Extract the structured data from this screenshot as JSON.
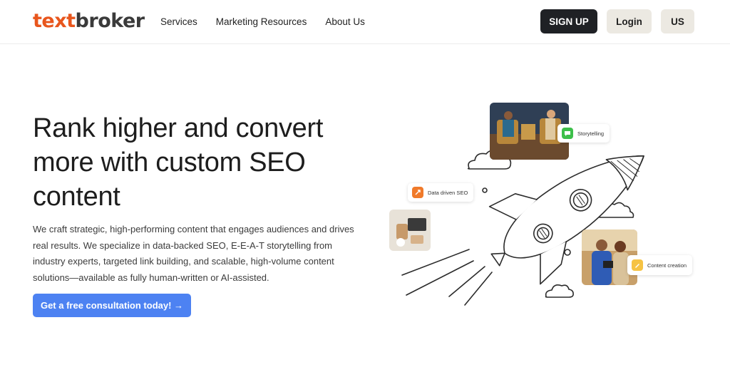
{
  "header": {
    "logo": {
      "part1": "text",
      "part2": "broker"
    },
    "nav": [
      "Services",
      "Marketing Resources",
      "About Us"
    ],
    "signup_label": "SIGN UP",
    "login_label": "Login",
    "region_label": "US"
  },
  "hero": {
    "title": "Rank higher and convert more with custom SEO content",
    "body": "We craft strategic, high-performing content that engages audiences and drives real results. We specialize in data-backed SEO, E-E-A-T storytelling from industry experts, targeted link building, and scalable, high-volume content solutions—available as fully human-written or AI-assisted.",
    "cta_label": "Get a free consultation today! →"
  },
  "illustration": {
    "chips": {
      "storytelling": "Storytelling",
      "data_driven": "Data driven SEO",
      "content_creation": "Content creation"
    }
  },
  "colors": {
    "brand_orange": "#e8561d",
    "cta_blue": "#4d82f2",
    "signup_bg": "#1f2125",
    "secondary_btn_bg": "#ece9e2"
  }
}
